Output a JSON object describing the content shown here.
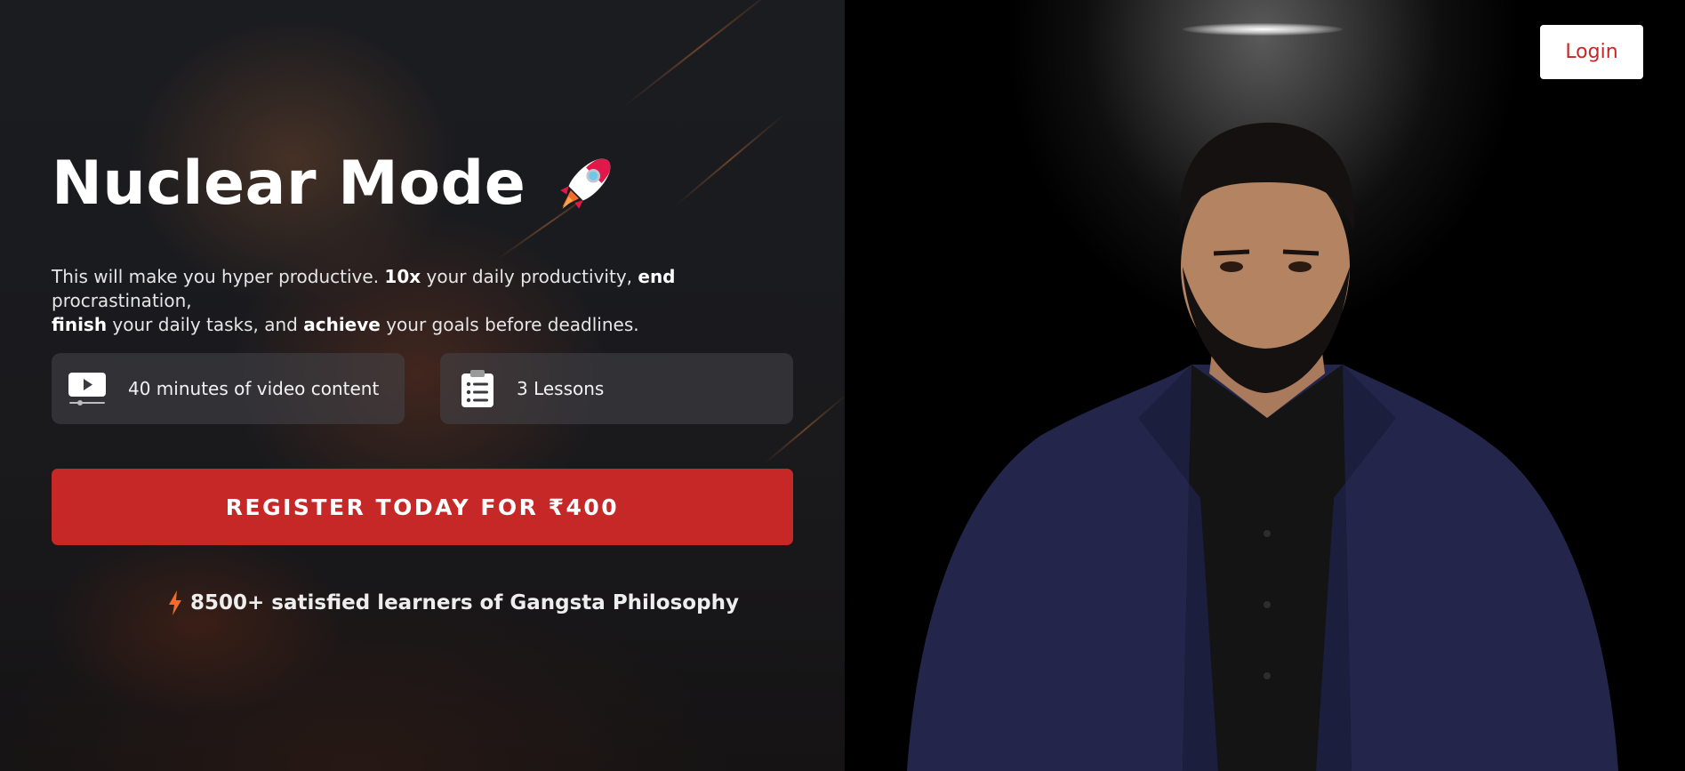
{
  "hero": {
    "title": "Nuclear Mode",
    "description": {
      "p1": "This will make you hyper productive. ",
      "b1": "10x",
      "p2": " your daily productivity, ",
      "b2": "end",
      "p3": " procrastination, ",
      "b3": "finish",
      "p4": " your daily tasks, and ",
      "b4": "achieve",
      "p5": " your goals before deadlines."
    },
    "features": [
      {
        "icon": "video-play-icon",
        "label": "40 minutes of video content"
      },
      {
        "icon": "clipboard-list-icon",
        "label": "3 Lessons"
      }
    ],
    "cta_label": "REGISTER TODAY FOR ₹400",
    "social_proof": "8500+ satisfied learners of Gangsta Philosophy"
  },
  "header": {
    "login_label": "Login"
  },
  "colors": {
    "accent": "#c62828",
    "bolt": "#f26b2b",
    "panel_bg": "#1b1c20"
  }
}
